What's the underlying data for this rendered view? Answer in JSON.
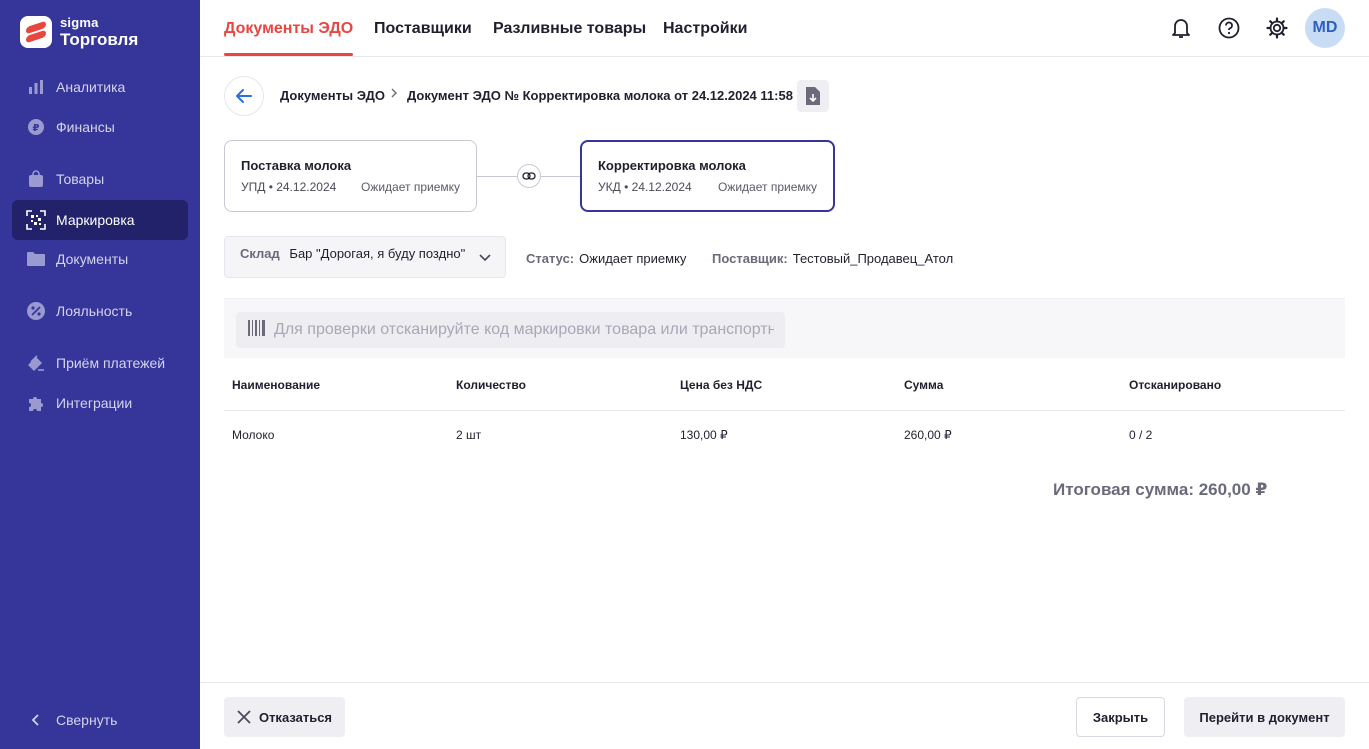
{
  "app": {
    "logo_line1": "sigma",
    "logo_line2": "Торговля",
    "accent_color": "#e8463f",
    "sidebar_color": "#35359a"
  },
  "sidebar": {
    "items": [
      {
        "label": "Аналитика",
        "icon": "bar-chart-icon"
      },
      {
        "label": "Финансы",
        "icon": "ruble-coin-icon"
      },
      {
        "label": "Товары",
        "icon": "shopping-bag-icon"
      },
      {
        "label": "Маркировка",
        "icon": "datamatrix-scan-icon",
        "active": true
      },
      {
        "label": "Документы",
        "icon": "folder-icon"
      },
      {
        "label": "Лояльность",
        "icon": "percent-badge-icon"
      },
      {
        "label": "Приём платежей",
        "icon": "card-stack-icon"
      },
      {
        "label": "Интеграции",
        "icon": "puzzle-icon"
      }
    ],
    "collapse_label": "Свернуть"
  },
  "topbar": {
    "tabs": [
      {
        "label": "Документы ЭДО",
        "active": true
      },
      {
        "label": "Поставщики"
      },
      {
        "label": "Разливные товары"
      },
      {
        "label": "Настройки"
      }
    ],
    "avatar_initials": "MD"
  },
  "breadcrumb": {
    "root": "Документы ЭДО",
    "current": "Документ ЭДО № Корректировка молока от 24.12.2024 11:58"
  },
  "documents": [
    {
      "title": "Поставка молока",
      "type": "УПД",
      "date": "24.12.2024",
      "status": "Ожидает приемку"
    },
    {
      "title": "Корректировка молока",
      "type": "УКД",
      "date": "24.12.2024",
      "status": "Ожидает приемку",
      "selected": true
    }
  ],
  "warehouse": {
    "label": "Склад",
    "value": "Бар \"Дорогая, я буду поздно\""
  },
  "status": {
    "label": "Статус:",
    "value": "Ожидает приемку"
  },
  "supplier": {
    "label": "Поставщик:",
    "value": "Тестовый_Продавец_Атол"
  },
  "scan": {
    "placeholder": "Для проверки отсканируйте код маркировки товара или транспортной упаковки"
  },
  "table": {
    "headers": [
      "Наименование",
      "Количество",
      "Цена без НДС",
      "Сумма",
      "Отсканировано"
    ],
    "rows": [
      [
        "Молоко",
        "2 шт",
        "130,00 ₽",
        "260,00 ₽",
        "0 / 2"
      ]
    ]
  },
  "total": "Итоговая сумма: 260,00 ₽",
  "footer": {
    "decline_label": "Отказаться",
    "close_label": "Закрыть",
    "go_label": "Перейти в документ"
  }
}
